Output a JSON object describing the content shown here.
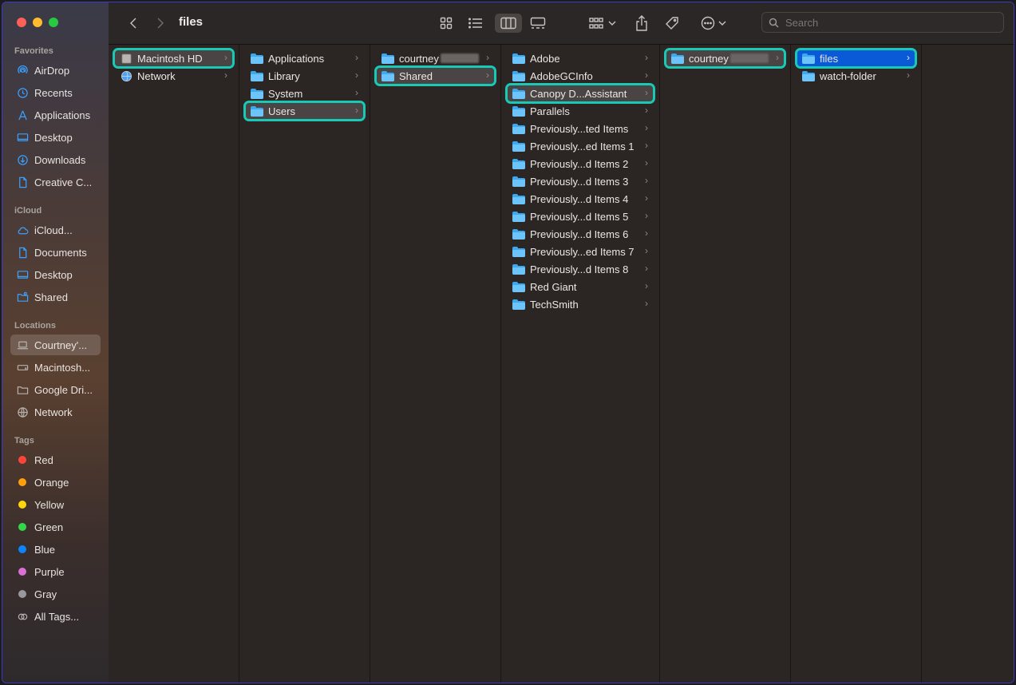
{
  "window": {
    "title": "files"
  },
  "toolbar": {
    "search_placeholder": "Search"
  },
  "sidebar": {
    "favorites_label": "Favorites",
    "favorites": [
      {
        "label": "AirDrop",
        "icon": "airdrop-icon"
      },
      {
        "label": "Recents",
        "icon": "clock-icon"
      },
      {
        "label": "Applications",
        "icon": "applications-icon"
      },
      {
        "label": "Desktop",
        "icon": "desktop-icon"
      },
      {
        "label": "Downloads",
        "icon": "download-icon"
      },
      {
        "label": "Creative C...",
        "icon": "document-icon"
      }
    ],
    "icloud_label": "iCloud",
    "icloud": [
      {
        "label": "iCloud...",
        "icon": "cloud-icon"
      },
      {
        "label": "Documents",
        "icon": "document-icon"
      },
      {
        "label": "Desktop",
        "icon": "desktop-icon"
      },
      {
        "label": "Shared",
        "icon": "shared-folder-icon"
      }
    ],
    "locations_label": "Locations",
    "locations": [
      {
        "label": "Courtney'...",
        "icon": "laptop-icon"
      },
      {
        "label": "Macintosh...",
        "icon": "disk-icon"
      },
      {
        "label": "Google Dri...",
        "icon": "folder-icon"
      },
      {
        "label": "Network",
        "icon": "globe-icon"
      }
    ],
    "tags_label": "Tags",
    "tags": [
      {
        "label": "Red",
        "color": "#ff453a"
      },
      {
        "label": "Orange",
        "color": "#ff9f0a"
      },
      {
        "label": "Yellow",
        "color": "#ffd60a"
      },
      {
        "label": "Green",
        "color": "#32d74b"
      },
      {
        "label": "Blue",
        "color": "#0a84ff"
      },
      {
        "label": "Purple",
        "color": "#da70d6"
      },
      {
        "label": "Gray",
        "color": "#98989d"
      }
    ],
    "all_tags_label": "All Tags..."
  },
  "columns": [
    {
      "items": [
        {
          "label": "Macintosh HD",
          "icon": "disk-icon"
        },
        {
          "label": "Network",
          "icon": "globe-icon"
        }
      ]
    },
    {
      "items": [
        {
          "label": "Applications",
          "icon": "folder-icon"
        },
        {
          "label": "Library",
          "icon": "folder-icon"
        },
        {
          "label": "System",
          "icon": "folder-icon"
        },
        {
          "label": "Users",
          "icon": "folder-icon"
        }
      ]
    },
    {
      "items": [
        {
          "label": "courtney",
          "icon": "home-folder-icon"
        },
        {
          "label": "Shared",
          "icon": "folder-icon"
        }
      ]
    },
    {
      "items": [
        {
          "label": "Adobe"
        },
        {
          "label": "AdobeGCInfo"
        },
        {
          "label": "Canopy D...Assistant"
        },
        {
          "label": "Parallels"
        },
        {
          "label": "Previously...ted Items"
        },
        {
          "label": "Previously...ed Items 1"
        },
        {
          "label": "Previously...d Items 2"
        },
        {
          "label": "Previously...d Items 3"
        },
        {
          "label": "Previously...d Items 4"
        },
        {
          "label": "Previously...d Items 5"
        },
        {
          "label": "Previously...d Items 6"
        },
        {
          "label": "Previously...ed Items 7"
        },
        {
          "label": "Previously...d Items 8"
        },
        {
          "label": "Red Giant"
        },
        {
          "label": "TechSmith"
        }
      ]
    },
    {
      "items": [
        {
          "label": "courtney"
        }
      ]
    },
    {
      "items": [
        {
          "label": "files"
        },
        {
          "label": "watch-folder"
        }
      ]
    }
  ],
  "colors": {
    "highlight": "#19c9b5",
    "selected": "#0a5ad8",
    "folder": "#3ba8f0"
  }
}
